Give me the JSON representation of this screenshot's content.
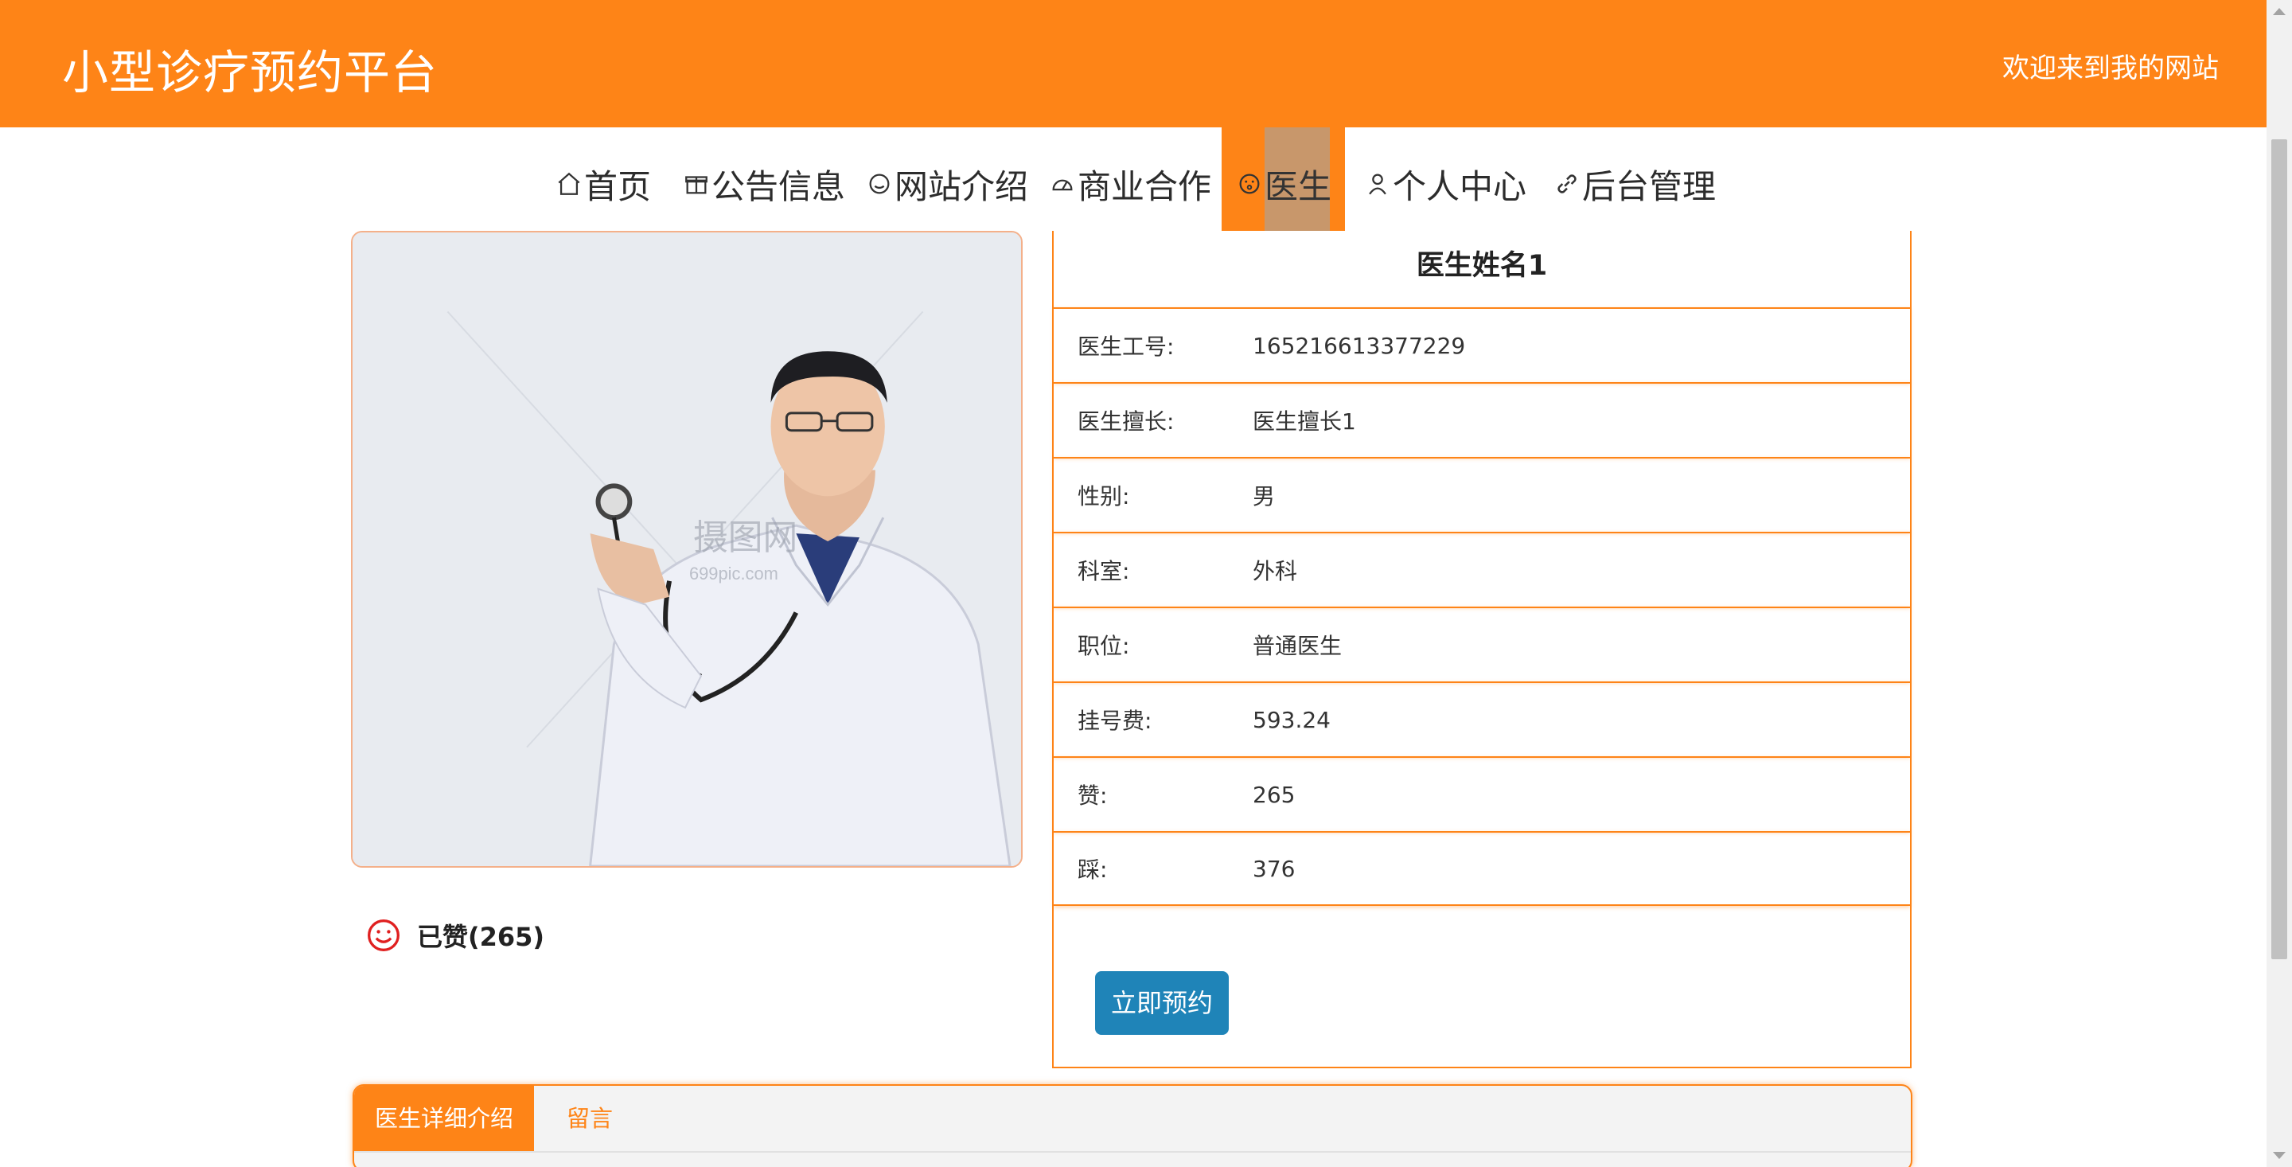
{
  "header": {
    "title": "小型诊疗预约平台",
    "welcome": "欢迎来到我的网站"
  },
  "nav": {
    "items": [
      {
        "label": "首页",
        "icon": "home-icon"
      },
      {
        "label": "公告信息",
        "icon": "gift-icon"
      },
      {
        "label": "网站介绍",
        "icon": "smile-icon"
      },
      {
        "label": "商业合作",
        "icon": "gauge-icon"
      },
      {
        "label": "医生",
        "icon": "face-icon"
      },
      {
        "label": "个人中心",
        "icon": "person-icon"
      },
      {
        "label": "后台管理",
        "icon": "link-icon"
      }
    ],
    "active_index": 4
  },
  "doctor": {
    "name": "医生姓名1",
    "photo_watermark": "摄图网",
    "photo_watermark_url": "699pic.com",
    "fields": [
      {
        "label": "医生工号:",
        "value": "165216613377229"
      },
      {
        "label": "医生擅长:",
        "value": "医生擅长1"
      },
      {
        "label": "性别:",
        "value": "男"
      },
      {
        "label": "科室:",
        "value": "外科"
      },
      {
        "label": "职位:",
        "value": "普通医生"
      },
      {
        "label": "挂号费:",
        "value": "593.24"
      },
      {
        "label": "赞:",
        "value": "265"
      },
      {
        "label": "踩:",
        "value": "376"
      }
    ],
    "liked_text": "已赞(265)",
    "book_button": "立即预约"
  },
  "tabs": [
    {
      "label": "医生详细介绍",
      "active": true
    },
    {
      "label": "留言",
      "active": false
    }
  ],
  "colors": {
    "brand": "#fe8417",
    "button": "#1f84b8",
    "like_icon": "#e02020"
  }
}
